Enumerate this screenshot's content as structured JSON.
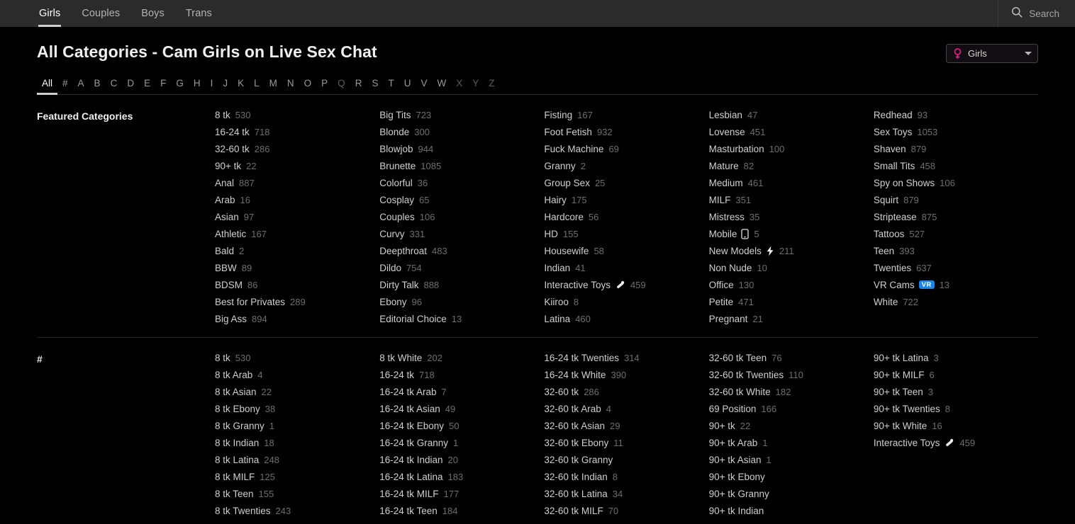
{
  "topnav": {
    "tabs": [
      {
        "label": "Girls",
        "active": true
      },
      {
        "label": "Couples",
        "active": false
      },
      {
        "label": "Boys",
        "active": false
      },
      {
        "label": "Trans",
        "active": false
      }
    ],
    "search_label": "Search",
    "search_icon": "search-icon"
  },
  "header": {
    "title": "All Categories - Cam Girls on Live Sex Chat",
    "gender_filter": {
      "value": "Girls",
      "icon": "venus-icon",
      "icon_color": "#e0218a",
      "caret_icon": "chevron-down-icon"
    }
  },
  "alphabet": {
    "items": [
      {
        "label": "All",
        "state": "active"
      },
      {
        "label": "#",
        "state": "normal"
      },
      {
        "label": "A",
        "state": "normal"
      },
      {
        "label": "B",
        "state": "normal"
      },
      {
        "label": "C",
        "state": "normal"
      },
      {
        "label": "D",
        "state": "normal"
      },
      {
        "label": "E",
        "state": "normal"
      },
      {
        "label": "F",
        "state": "normal"
      },
      {
        "label": "G",
        "state": "normal"
      },
      {
        "label": "H",
        "state": "normal"
      },
      {
        "label": "I",
        "state": "normal"
      },
      {
        "label": "J",
        "state": "normal"
      },
      {
        "label": "K",
        "state": "normal"
      },
      {
        "label": "L",
        "state": "normal"
      },
      {
        "label": "M",
        "state": "normal"
      },
      {
        "label": "N",
        "state": "normal"
      },
      {
        "label": "O",
        "state": "normal"
      },
      {
        "label": "P",
        "state": "normal"
      },
      {
        "label": "Q",
        "state": "dim"
      },
      {
        "label": "R",
        "state": "normal"
      },
      {
        "label": "S",
        "state": "normal"
      },
      {
        "label": "T",
        "state": "normal"
      },
      {
        "label": "U",
        "state": "normal"
      },
      {
        "label": "V",
        "state": "normal"
      },
      {
        "label": "W",
        "state": "normal"
      },
      {
        "label": "X",
        "state": "dim"
      },
      {
        "label": "Y",
        "state": "dim"
      },
      {
        "label": "Z",
        "state": "dim"
      }
    ]
  },
  "sections": [
    {
      "title": "Featured Categories",
      "columns": [
        [
          {
            "name": "8 tk",
            "count": "530"
          },
          {
            "name": "16-24 tk",
            "count": "718"
          },
          {
            "name": "32-60 tk",
            "count": "286"
          },
          {
            "name": "90+ tk",
            "count": "22"
          },
          {
            "name": "Anal",
            "count": "887"
          },
          {
            "name": "Arab",
            "count": "16"
          },
          {
            "name": "Asian",
            "count": "97"
          },
          {
            "name": "Athletic",
            "count": "167"
          },
          {
            "name": "Bald",
            "count": "2"
          },
          {
            "name": "BBW",
            "count": "89"
          },
          {
            "name": "BDSM",
            "count": "86"
          },
          {
            "name": "Best for Privates",
            "count": "289"
          },
          {
            "name": "Big Ass",
            "count": "894"
          }
        ],
        [
          {
            "name": "Big Tits",
            "count": "723"
          },
          {
            "name": "Blonde",
            "count": "300"
          },
          {
            "name": "Blowjob",
            "count": "944"
          },
          {
            "name": "Brunette",
            "count": "1085"
          },
          {
            "name": "Colorful",
            "count": "36"
          },
          {
            "name": "Cosplay",
            "count": "65"
          },
          {
            "name": "Couples",
            "count": "106"
          },
          {
            "name": "Curvy",
            "count": "331"
          },
          {
            "name": "Deepthroat",
            "count": "483"
          },
          {
            "name": "Dildo",
            "count": "754"
          },
          {
            "name": "Dirty Talk",
            "count": "888"
          },
          {
            "name": "Ebony",
            "count": "96"
          },
          {
            "name": "Editorial Choice",
            "count": "13"
          }
        ],
        [
          {
            "name": "Fisting",
            "count": "167"
          },
          {
            "name": "Foot Fetish",
            "count": "932"
          },
          {
            "name": "Fuck Machine",
            "count": "69"
          },
          {
            "name": "Granny",
            "count": "2"
          },
          {
            "name": "Group Sex",
            "count": "25"
          },
          {
            "name": "Hairy",
            "count": "175"
          },
          {
            "name": "Hardcore",
            "count": "56"
          },
          {
            "name": "HD",
            "count": "155"
          },
          {
            "name": "Housewife",
            "count": "58"
          },
          {
            "name": "Indian",
            "count": "41"
          },
          {
            "name": "Interactive Toys",
            "count": "459",
            "icon": "toy-wand-icon"
          },
          {
            "name": "Kiiroo",
            "count": "8"
          },
          {
            "name": "Latina",
            "count": "460"
          }
        ],
        [
          {
            "name": "Lesbian",
            "count": "47"
          },
          {
            "name": "Lovense",
            "count": "451"
          },
          {
            "name": "Masturbation",
            "count": "100"
          },
          {
            "name": "Mature",
            "count": "82"
          },
          {
            "name": "Medium",
            "count": "461"
          },
          {
            "name": "MILF",
            "count": "351"
          },
          {
            "name": "Mistress",
            "count": "35"
          },
          {
            "name": "Mobile",
            "count": "5",
            "icon": "mobile-phone-icon"
          },
          {
            "name": "New Models",
            "count": "211",
            "icon": "lightning-bolt-icon"
          },
          {
            "name": "Non Nude",
            "count": "10"
          },
          {
            "name": "Office",
            "count": "130"
          },
          {
            "name": "Petite",
            "count": "471"
          },
          {
            "name": "Pregnant",
            "count": "21"
          }
        ],
        [
          {
            "name": "Redhead",
            "count": "93"
          },
          {
            "name": "Sex Toys",
            "count": "1053"
          },
          {
            "name": "Shaven",
            "count": "879"
          },
          {
            "name": "Small Tits",
            "count": "458"
          },
          {
            "name": "Spy on Shows",
            "count": "106"
          },
          {
            "name": "Squirt",
            "count": "879"
          },
          {
            "name": "Striptease",
            "count": "875"
          },
          {
            "name": "Tattoos",
            "count": "527"
          },
          {
            "name": "Teen",
            "count": "393"
          },
          {
            "name": "Twenties",
            "count": "637"
          },
          {
            "name": "VR Cams",
            "count": "13",
            "badge": "VR"
          },
          {
            "name": "White",
            "count": "722"
          }
        ]
      ]
    },
    {
      "title": "#",
      "columns": [
        [
          {
            "name": "8 tk",
            "count": "530"
          },
          {
            "name": "8 tk Arab",
            "count": "4"
          },
          {
            "name": "8 tk Asian",
            "count": "22"
          },
          {
            "name": "8 tk Ebony",
            "count": "38"
          },
          {
            "name": "8 tk Granny",
            "count": "1"
          },
          {
            "name": "8 tk Indian",
            "count": "18"
          },
          {
            "name": "8 tk Latina",
            "count": "248"
          },
          {
            "name": "8 tk MILF",
            "count": "125"
          },
          {
            "name": "8 tk Teen",
            "count": "155"
          },
          {
            "name": "8 tk Twenties",
            "count": "243"
          }
        ],
        [
          {
            "name": "8 tk White",
            "count": "202"
          },
          {
            "name": "16-24 tk",
            "count": "718"
          },
          {
            "name": "16-24 tk Arab",
            "count": "7"
          },
          {
            "name": "16-24 tk Asian",
            "count": "49"
          },
          {
            "name": "16-24 tk Ebony",
            "count": "50"
          },
          {
            "name": "16-24 tk Granny",
            "count": "1"
          },
          {
            "name": "16-24 tk Indian",
            "count": "20"
          },
          {
            "name": "16-24 tk Latina",
            "count": "183"
          },
          {
            "name": "16-24 tk MILF",
            "count": "177"
          },
          {
            "name": "16-24 tk Teen",
            "count": "184"
          }
        ],
        [
          {
            "name": "16-24 tk Twenties",
            "count": "314"
          },
          {
            "name": "16-24 tk White",
            "count": "390"
          },
          {
            "name": "32-60 tk",
            "count": "286"
          },
          {
            "name": "32-60 tk Arab",
            "count": "4"
          },
          {
            "name": "32-60 tk Asian",
            "count": "29"
          },
          {
            "name": "32-60 tk Ebony",
            "count": "11"
          },
          {
            "name": "32-60 tk Granny",
            "count": ""
          },
          {
            "name": "32-60 tk Indian",
            "count": "8"
          },
          {
            "name": "32-60 tk Latina",
            "count": "34"
          },
          {
            "name": "32-60 tk MILF",
            "count": "70"
          }
        ],
        [
          {
            "name": "32-60 tk Teen",
            "count": "76"
          },
          {
            "name": "32-60 tk Twenties",
            "count": "110"
          },
          {
            "name": "32-60 tk White",
            "count": "182"
          },
          {
            "name": "69 Position",
            "count": "166"
          },
          {
            "name": "90+ tk",
            "count": "22"
          },
          {
            "name": "90+ tk Arab",
            "count": "1"
          },
          {
            "name": "90+ tk Asian",
            "count": "1"
          },
          {
            "name": "90+ tk Ebony",
            "count": ""
          },
          {
            "name": "90+ tk Granny",
            "count": ""
          },
          {
            "name": "90+ tk Indian",
            "count": ""
          }
        ],
        [
          {
            "name": "90+ tk Latina",
            "count": "3"
          },
          {
            "name": "90+ tk MILF",
            "count": "6"
          },
          {
            "name": "90+ tk Teen",
            "count": "3"
          },
          {
            "name": "90+ tk Twenties",
            "count": "8"
          },
          {
            "name": "90+ tk White",
            "count": "16"
          },
          {
            "name": "Interactive Toys",
            "count": "459",
            "icon": "toy-wand-icon"
          }
        ]
      ]
    }
  ]
}
